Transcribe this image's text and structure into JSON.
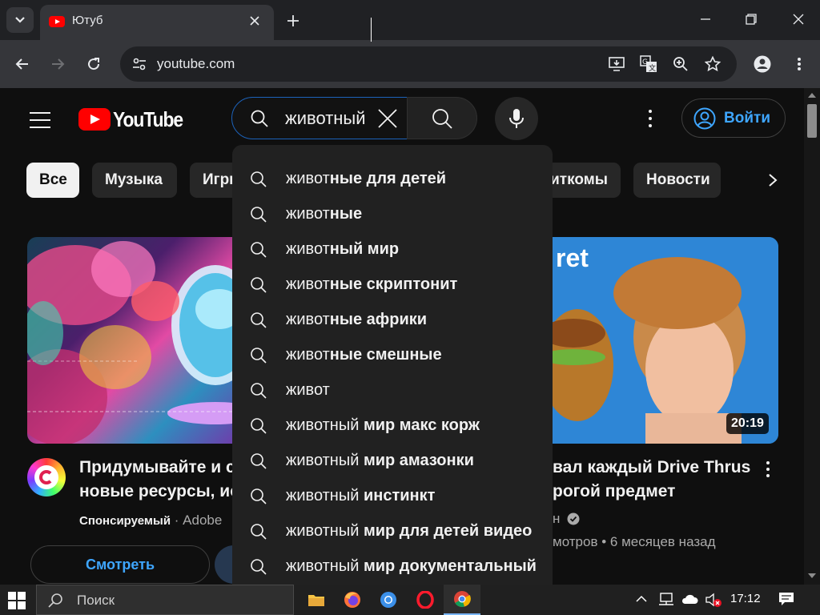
{
  "browser": {
    "tab_title": "Ютуб",
    "url": "youtube.com"
  },
  "youtube": {
    "logo_text": "YouTube",
    "search_value": "животный",
    "signin_label": "Войти",
    "chips": [
      "Все",
      "Музыка",
      "Игры",
      "Ситкомы",
      "Новости"
    ],
    "suggestions": [
      {
        "typed": "живот",
        "rest": "ные для детей"
      },
      {
        "typed": "живот",
        "rest": "ные"
      },
      {
        "typed": "живот",
        "rest": "ный мир"
      },
      {
        "typed": "живот",
        "rest": "ные скриптонит"
      },
      {
        "typed": "живот",
        "rest": "ные африки"
      },
      {
        "typed": "живот",
        "rest": "ные смешные"
      },
      {
        "typed": "живот",
        "rest": ""
      },
      {
        "typed": "животный",
        "rest": " мир макс корж"
      },
      {
        "typed": "животный",
        "rest": " мир амазонки"
      },
      {
        "typed": "животный",
        "rest": " инстинкт"
      },
      {
        "typed": "животный",
        "rest": " мир для детей видео"
      },
      {
        "typed": "животный",
        "rest": " мир документальный"
      }
    ],
    "video1": {
      "title_line1": "Придумывайте и создавайте",
      "title_line2": "новые ресурсы, используя",
      "sponsored": "Спонсируемый",
      "channel": "Adobe",
      "watch_label": "Смотреть"
    },
    "video2": {
      "thumb_text": "ret",
      "duration": "20:19",
      "title_line1": "вал каждый Drive Thrus",
      "title_line2": "рогой предмет",
      "channel_tail": "н",
      "views_tail": "мотров",
      "age": "6 месяцев назад"
    }
  },
  "taskbar": {
    "search_placeholder": "Поиск",
    "time": "17:12"
  },
  "colors": {
    "accent_blue": "#3ea6ff",
    "youtube_red": "#ff0000",
    "background": "#0f0f0f"
  }
}
